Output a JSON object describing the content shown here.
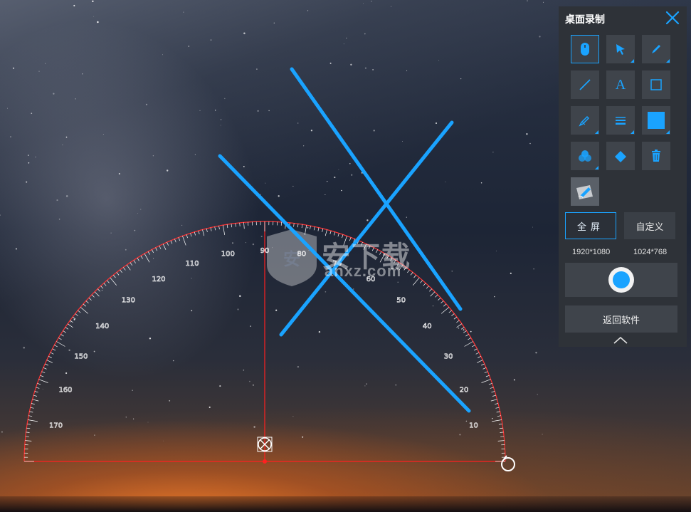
{
  "panel": {
    "title": "桌面录制",
    "close_icon": "close-icon",
    "tools": [
      {
        "name": "mouse-tool",
        "icon": "mouse-icon",
        "active": true
      },
      {
        "name": "pointer-tool",
        "icon": "arrow-pointer-icon"
      },
      {
        "name": "pen-tool",
        "icon": "pencil-icon"
      },
      {
        "name": "line-tool",
        "icon": "line-icon"
      },
      {
        "name": "text-tool",
        "icon": "text-icon",
        "label": "A"
      },
      {
        "name": "rectangle-tool",
        "icon": "square-outline-icon"
      },
      {
        "name": "highlighter-tool",
        "icon": "highlighter-icon"
      },
      {
        "name": "line-weight-tool",
        "icon": "line-weight-icon"
      },
      {
        "name": "color-tool",
        "icon": "color-swatch-icon"
      },
      {
        "name": "opacity-tool",
        "icon": "circles-icon"
      },
      {
        "name": "eraser-tool",
        "icon": "eraser-icon"
      },
      {
        "name": "delete-tool",
        "icon": "trash-icon"
      },
      {
        "name": "whiteboard-tool",
        "icon": "whiteboard-pen-icon"
      }
    ],
    "mode_fullscreen": "全屏",
    "mode_custom": "自定义",
    "res_fullscreen": "1920*1080",
    "res_custom": "1024*768",
    "record_icon": "record-icon",
    "return_label": "返回软件",
    "collapse_icon": "chevron-up-icon"
  },
  "protractor": {
    "labels": [
      "10",
      "20",
      "30",
      "40",
      "50",
      "60",
      "70",
      "80",
      "90",
      "100",
      "110",
      "120",
      "130",
      "140",
      "150",
      "160",
      "170"
    ]
  },
  "watermark": {
    "shield_char": "安",
    "text": "安下载",
    "sub": "anxz.com"
  },
  "colors": {
    "accent": "#1aa3ff",
    "panel_bg": "#2e3238",
    "button_bg": "#3f444b",
    "protractor": "#ff2020"
  }
}
